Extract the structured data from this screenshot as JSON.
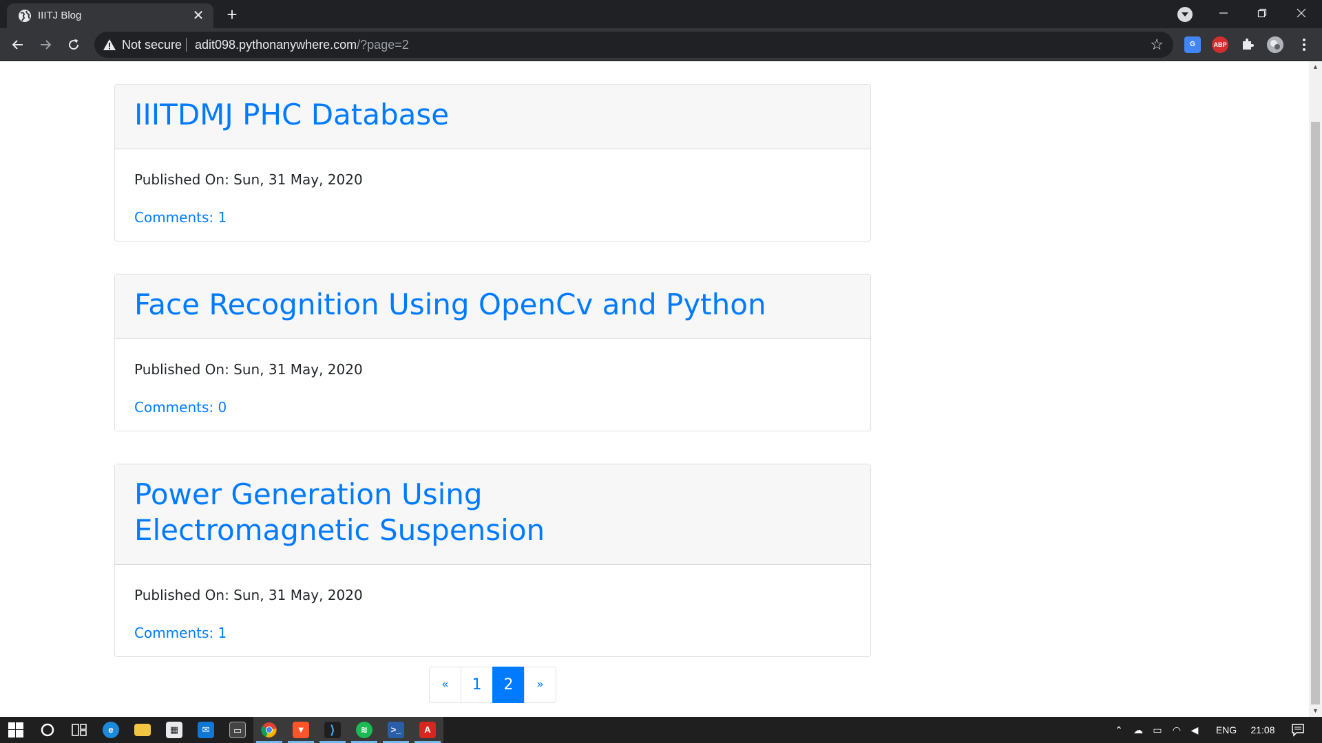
{
  "browser": {
    "tab_title": "IIITJ Blog",
    "tab_close": "✕",
    "new_tab": "+",
    "security_label": "Not secure",
    "url_host": "adit098.pythonanywhere.com",
    "url_path": "/?page=2",
    "extensions": [
      "google-translate-icon",
      "adblock-plus-icon",
      "puzzle-extensions-icon",
      "profile-avatar"
    ]
  },
  "posts": [
    {
      "title": "IIITDMJ PHC Database",
      "published": "Published On: Sun, 31 May, 2020",
      "comments": "Comments: 1"
    },
    {
      "title": "Face Recognition Using OpenCv and Python",
      "published": "Published On: Sun, 31 May, 2020",
      "comments": "Comments: 0"
    },
    {
      "title": "Power Generation Using Electromagnetic Suspension",
      "published": "Published On: Sun, 31 May, 2020",
      "comments": "Comments: 1"
    }
  ],
  "pagination": {
    "prev": "«",
    "pages": [
      "1",
      "2"
    ],
    "current": "2",
    "next": "»"
  },
  "taskbar": {
    "language": "ENG",
    "time": "21:08",
    "apps": [
      "start-icon",
      "cortana-icon",
      "task-view-icon",
      "edge-icon",
      "file-explorer-icon",
      "store-icon",
      "mail-icon",
      "terminal-icon",
      "chrome-icon",
      "brave-icon",
      "vscode-icon",
      "spotify-icon",
      "powershell-icon",
      "acrobat-icon"
    ]
  },
  "colors": {
    "link": "#007bff",
    "active_page": "#007bff",
    "card_header": "#f7f7f7"
  }
}
